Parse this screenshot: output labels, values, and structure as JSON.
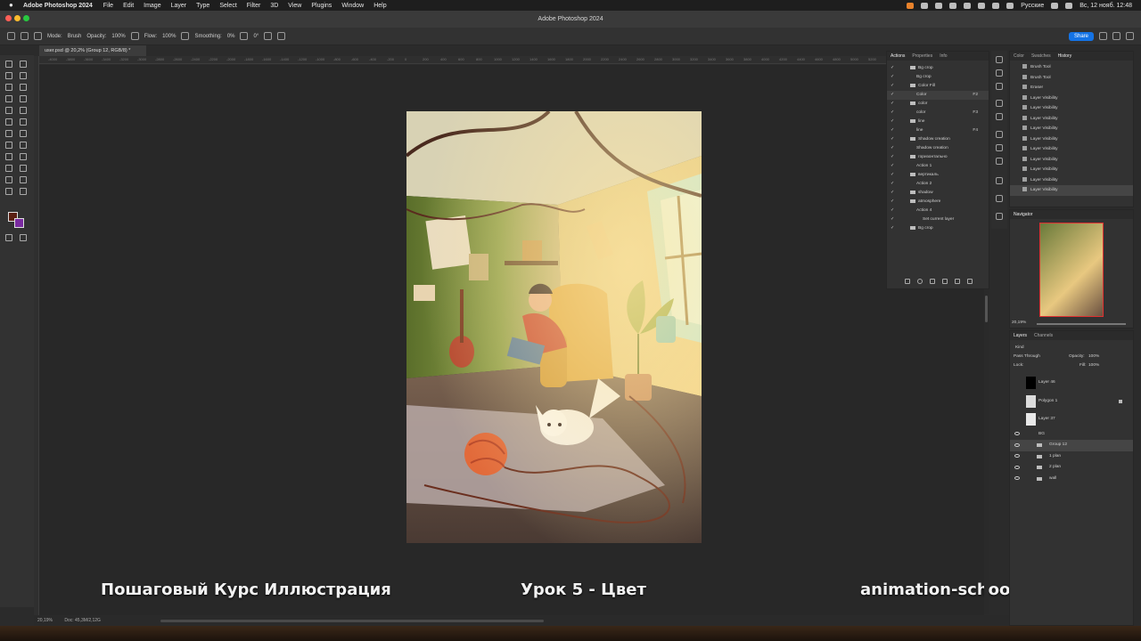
{
  "menubar": {
    "app_name": "Adobe Photoshop 2024",
    "items": [
      "File",
      "Edit",
      "Image",
      "Layer",
      "Type",
      "Select",
      "Filter",
      "3D",
      "View",
      "Plugins",
      "Window",
      "Help"
    ],
    "language": "Русские",
    "clock": "Вс, 12 нояб.  12:48"
  },
  "window": {
    "title": "Adobe Photoshop 2024"
  },
  "options": {
    "mode_label": "Mode:",
    "mode_value": "Brush",
    "opacity_label": "Opacity:",
    "opacity_value": "100%",
    "flow_label": "Flow:",
    "flow_value": "100%",
    "smoothing_label": "Smoothing:",
    "smoothing_value": "0%",
    "angle_value": "0°",
    "share_label": "Share"
  },
  "document": {
    "tab_label": "user.psd @ 20,2% (Group 12, RGB/8) *",
    "zoom": "20,19%",
    "doc_size": "Doc: 45,3M/2,12G"
  },
  "ruler_labels": [
    "-4000",
    "-3800",
    "-3600",
    "-3400",
    "-3200",
    "-3000",
    "-2800",
    "-2600",
    "-2400",
    "-2200",
    "-2000",
    "-1800",
    "-1600",
    "-1400",
    "-1200",
    "-1000",
    "-800",
    "-600",
    "-400",
    "-200",
    "0",
    "200",
    "400",
    "600",
    "800",
    "1000",
    "1200",
    "1400",
    "1600",
    "1800",
    "2000",
    "2200",
    "2400",
    "2600",
    "2800",
    "3000",
    "3200",
    "3400",
    "3600",
    "3800",
    "4000",
    "4200",
    "4400",
    "4600",
    "4800",
    "5000",
    "5200"
  ],
  "actions_panel": {
    "tabs": [
      "Actions",
      "Properties",
      "Info"
    ],
    "rows": [
      {
        "label": "Bg crop",
        "indent": 1,
        "type": "folder"
      },
      {
        "label": "Bg crop",
        "indent": 2,
        "type": "item"
      },
      {
        "label": "Color Fill",
        "indent": 1,
        "type": "folder"
      },
      {
        "label": "Color",
        "indent": 2,
        "type": "item",
        "key": "F2"
      },
      {
        "label": "color",
        "indent": 1,
        "type": "folder"
      },
      {
        "label": "color",
        "indent": 2,
        "type": "item",
        "key": "F3"
      },
      {
        "label": "line",
        "indent": 1,
        "type": "folder"
      },
      {
        "label": "line",
        "indent": 2,
        "type": "item",
        "key": "F4"
      },
      {
        "label": "Shadow creation",
        "indent": 1,
        "type": "folder"
      },
      {
        "label": "Shadow creation",
        "indent": 2,
        "type": "item"
      },
      {
        "label": "горизонтально",
        "indent": 1,
        "type": "folder"
      },
      {
        "label": "Action 1",
        "indent": 2,
        "type": "item"
      },
      {
        "label": "вертикаль",
        "indent": 1,
        "type": "folder"
      },
      {
        "label": "Action 2",
        "indent": 2,
        "type": "item"
      },
      {
        "label": "shadow",
        "indent": 1,
        "type": "folder"
      },
      {
        "label": "atmosphere",
        "indent": 1,
        "type": "folder"
      },
      {
        "label": "Action 4",
        "indent": 2,
        "type": "item"
      },
      {
        "label": "Set current layer",
        "indent": 3,
        "type": "item"
      },
      {
        "label": "Bg crop",
        "indent": 1,
        "type": "folder"
      }
    ]
  },
  "history_panel": {
    "tabs": [
      "Color",
      "Swatches",
      "History"
    ],
    "rows": [
      "Brush Tool",
      "Brush Tool",
      "Eraser",
      "Layer Visibility",
      "Layer Visibility",
      "Layer Visibility",
      "Layer Visibility",
      "Layer Visibility",
      "Layer Visibility",
      "Layer Visibility",
      "Layer Visibility",
      "Layer Visibility",
      "Layer Visibility"
    ]
  },
  "navigator_panel": {
    "title": "Navigator",
    "zoom": "20,19%"
  },
  "layers_panel": {
    "tabs": [
      "Layers",
      "Channels"
    ],
    "filter_label": "Kind",
    "blend_mode": "Pass Through",
    "opacity_label": "Opacity:",
    "opacity_value": "100%",
    "lock_label": "Lock:",
    "fill_label": "Fill:",
    "fill_value": "100%",
    "layers": [
      {
        "name": "Layer 46",
        "thumb": "#000000",
        "visible": false
      },
      {
        "name": "Polygon 1",
        "thumb": "#dcdcdc",
        "visible": false
      },
      {
        "name": "Layer 37",
        "thumb": "#e8e8e8",
        "visible": false
      },
      {
        "name": "BG",
        "thumb": "",
        "visible": true
      },
      {
        "name": "Group 12",
        "thumb": "",
        "visible": true
      },
      {
        "name": "1 plan",
        "thumb": "",
        "visible": true
      },
      {
        "name": "2 plan",
        "thumb": "",
        "visible": true
      },
      {
        "name": "wall",
        "thumb": "",
        "visible": true
      }
    ]
  },
  "captions": {
    "left": "Пошаговый Курс Иллюстрация",
    "center": "Урок 5 - Цвет",
    "right": "animation-school.pro"
  },
  "colors": {
    "foreground": "#5a1f12",
    "background": "#7a2aa0",
    "accent": "#1473e6"
  }
}
